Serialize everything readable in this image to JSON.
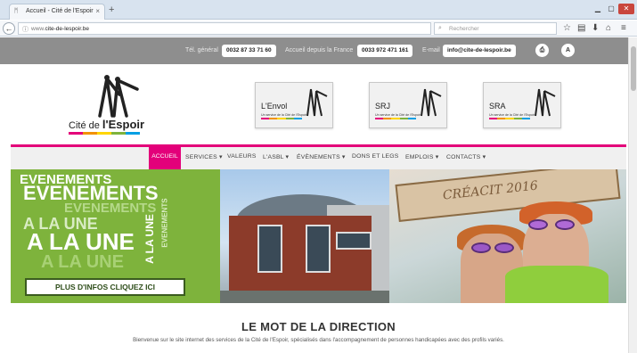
{
  "browser": {
    "tab_title": "Accueil - Cité de l'Espoir",
    "url_prefix": "www.",
    "url_domain": "cite-de-lespoir.be",
    "search_placeholder": "Rechercher"
  },
  "infobar": {
    "tel_label": "Tél. général",
    "tel_value": "0032 87 33 71 60",
    "france_label": "Accueil depuis la France",
    "france_value": "0033 972 471 161",
    "email_label": "E-mail",
    "email_value": "info@cite-de-lespoir.be",
    "font_size_button": "A"
  },
  "logo": {
    "prefix": "Cité de ",
    "strong": "l'Espoir"
  },
  "services": [
    {
      "name": "L'Envol",
      "sub": "Un service de la Cité de l'Espoir"
    },
    {
      "name": "SRJ",
      "sub": "Un service de la Cité de l'Espoir"
    },
    {
      "name": "SRA",
      "sub": "Un service de la Cité de l'Espoir"
    }
  ],
  "nav": {
    "items": [
      "ACCUEIL",
      "SERVICES ▾",
      "VALEURS",
      "L'ASBL ▾",
      "ÉVÈNEMENTS ▾",
      "DONS ET LEGS",
      "EMPLOIS ▾",
      "CONTACTS ▾"
    ]
  },
  "banner": {
    "words": [
      "EVENEMENTS",
      "A LA UNE"
    ],
    "cta": "PLUS D'INFOS CLIQUEZ ICI",
    "sign_text": "CRÉACIT 2016"
  },
  "content": {
    "title": "LE MOT DE LA DIRECTION",
    "intro": "Bienvenue sur le site internet des services de la Cité de l'Espoir, spécialisés dans l'accompagnement de personnes handicapées avec des profils variés."
  },
  "colors": {
    "accent": "#e3007a",
    "banner_green": "#7eb33c",
    "infobar_grey": "#8e8e8e"
  }
}
